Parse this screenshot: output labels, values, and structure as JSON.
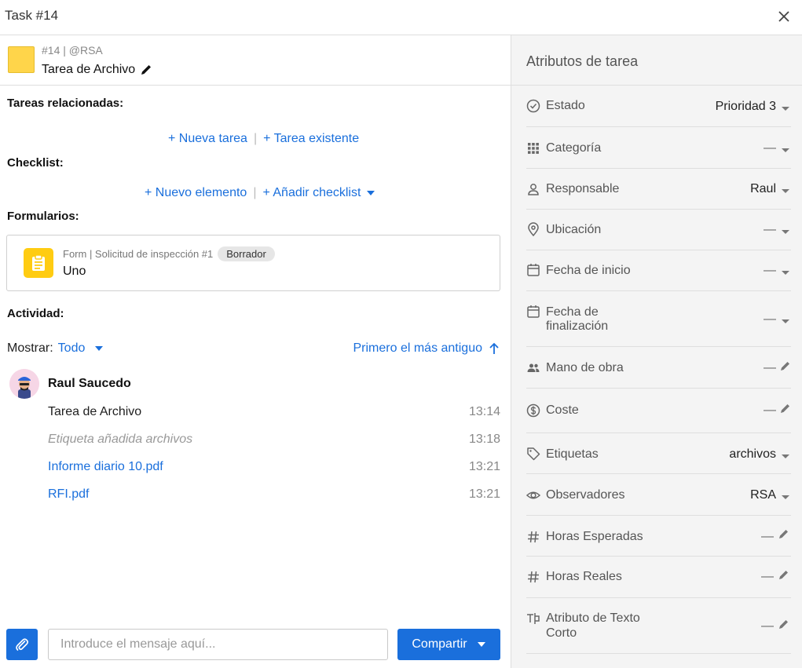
{
  "window": {
    "title": "Task #14"
  },
  "task": {
    "meta": "#14 | @RSA",
    "name": "Tarea de Archivo",
    "color": "#ffd54a"
  },
  "related": {
    "label": "Tareas relacionadas:",
    "new_task": "+ Nueva tarea",
    "existing_task": "+ Tarea existente"
  },
  "checklist": {
    "label": "Checklist:",
    "new_item": "+ Nuevo elemento",
    "add_checklist": "+ Añadir checklist"
  },
  "forms": {
    "label": "Formularios:",
    "items": [
      {
        "meta": "Form | Solicitud de inspección #1",
        "status": "Borrador",
        "name": "Uno"
      }
    ]
  },
  "activity": {
    "label": "Actividad:",
    "show_label": "Mostrar:",
    "show_value": "Todo",
    "sort_label": "Primero el más antiguo",
    "author": "Raul Saucedo",
    "entries": [
      {
        "text": "Tarea de Archivo",
        "time": "13:14"
      },
      {
        "text": "Etiqueta añadida archivos",
        "time": "13:18"
      },
      {
        "text": "Informe diario 10.pdf",
        "time": "13:21"
      },
      {
        "text": "RFI.pdf",
        "time": "13:21"
      }
    ]
  },
  "composer": {
    "placeholder": "Introduce el mensaje aquí...",
    "share_label": "Compartir"
  },
  "attributes": {
    "title": "Atributos de tarea",
    "rows": [
      {
        "icon": "check-circle-icon",
        "label": "Estado",
        "value": "Prioridad 3",
        "control": "dropdown"
      },
      {
        "icon": "grid-icon",
        "label": "Categoría",
        "value": "—",
        "control": "dropdown"
      },
      {
        "icon": "person-icon",
        "label": "Responsable",
        "value": "Raul",
        "control": "dropdown"
      },
      {
        "icon": "location-pin-icon",
        "label": "Ubicación",
        "value": "—",
        "control": "dropdown"
      },
      {
        "icon": "calendar-icon",
        "label": "Fecha de inicio",
        "value": "—",
        "control": "dropdown"
      },
      {
        "icon": "calendar-icon",
        "label_line1": "Fecha de",
        "label_line2": "finalización",
        "value": "—",
        "control": "dropdown"
      },
      {
        "icon": "people-icon",
        "label": "Mano de obra",
        "value": "—",
        "control": "edit"
      },
      {
        "icon": "dollar-icon",
        "label": "Coste",
        "value": "—",
        "control": "edit"
      },
      {
        "icon": "tag-icon",
        "label": "Etiquetas",
        "value": "archivos",
        "control": "dropdown"
      },
      {
        "icon": "eye-icon",
        "label": "Observadores",
        "value": "RSA",
        "control": "dropdown"
      },
      {
        "icon": "hash-icon",
        "label": "Horas Esperadas",
        "value": "—",
        "control": "edit"
      },
      {
        "icon": "hash-icon",
        "label": "Horas Reales",
        "value": "—",
        "control": "edit"
      },
      {
        "icon": "text-field-icon",
        "label_line1": "Atributo de Texto",
        "label_line2": "Corto",
        "value": "—",
        "control": "edit"
      }
    ]
  }
}
